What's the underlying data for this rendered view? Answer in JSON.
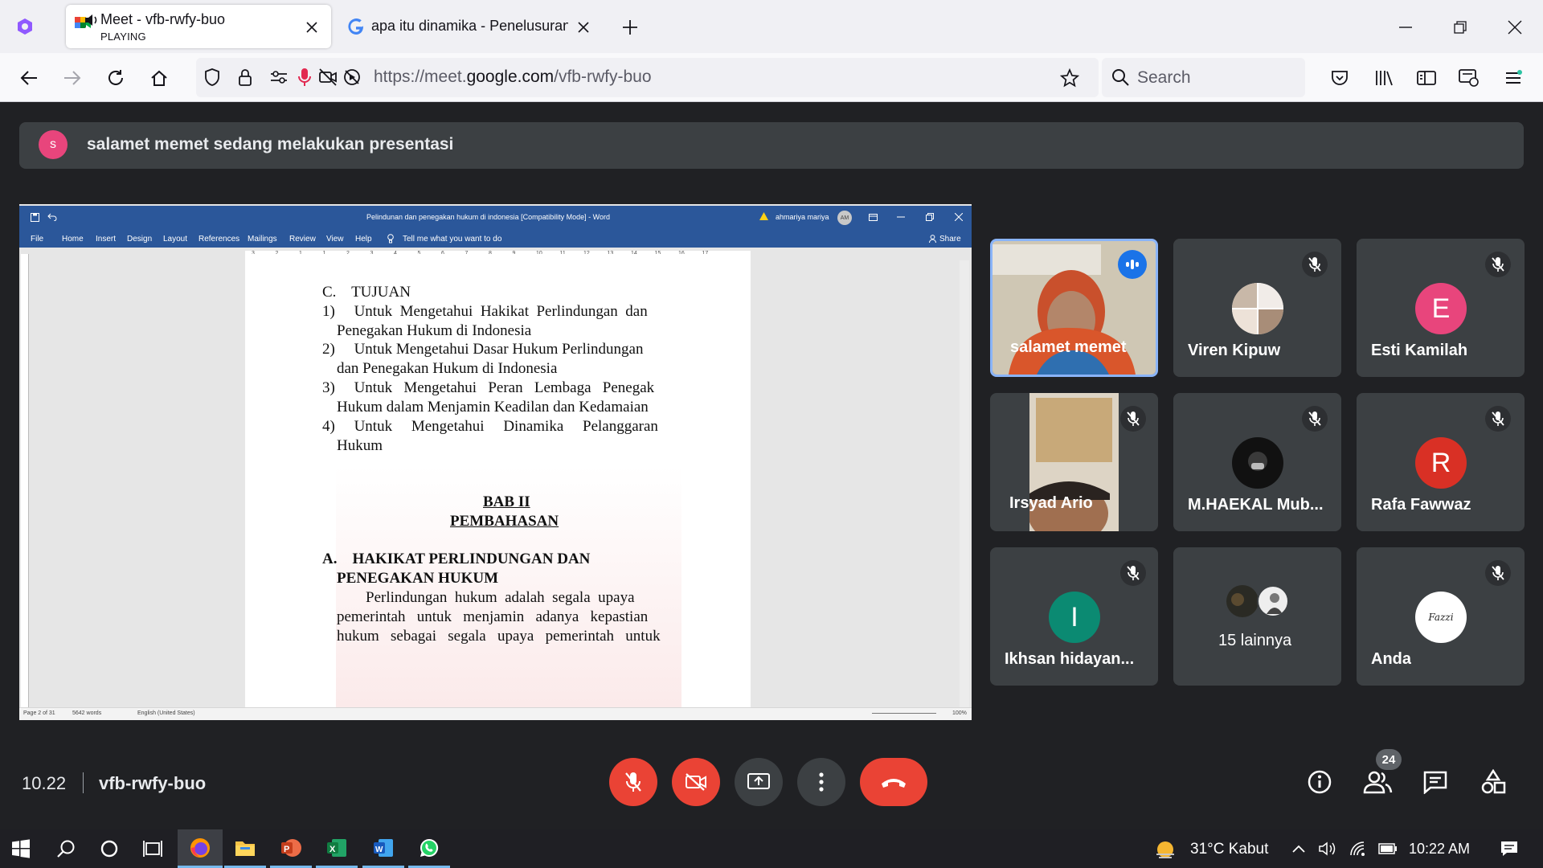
{
  "browser": {
    "tabs": [
      {
        "title": "Meet - vfb-rwfy-buo",
        "subtitle": "PLAYING",
        "active": true
      },
      {
        "title": "apa itu dinamika - Penelusuran Google",
        "active": false
      }
    ],
    "url": {
      "prefix": "https://meet.",
      "domain": "google.com",
      "path": "/vfb-rwfy-buo"
    },
    "search_placeholder": "Search",
    "icons": [
      "extensions-icon",
      "back-icon",
      "forward-icon",
      "reload-icon",
      "home-icon",
      "shield-icon",
      "lock-icon",
      "permissions-icon",
      "microphone-icon",
      "camera-off-icon",
      "autoplay-blocked-icon",
      "bookmark-star-icon",
      "pocket-icon",
      "library-icon",
      "sidebar-icon",
      "synced-tabs-icon",
      "menu-icon"
    ]
  },
  "meet": {
    "banner": {
      "avatar_letter": "s",
      "text": "salamet memet sedang melakukan presentasi",
      "avatar_color": "#e8457c"
    },
    "word": {
      "title": "Pelindunan dan penegakan hukum di indonesia [Compatibility Mode] - Word",
      "user": "ahmariya mariya",
      "user_initials": "AM",
      "ribbon": [
        "File",
        "Home",
        "Insert",
        "Design",
        "Layout",
        "References",
        "Mailings",
        "Review",
        "View",
        "Help",
        "Tell me what you want to do",
        "Share"
      ],
      "status": {
        "page": "Page 2 of 31",
        "words": "5642 words",
        "language": "English (United States)",
        "zoom": "100%"
      },
      "ruler_numbers": [
        "3",
        "2",
        "1",
        "1",
        "2",
        "3",
        "4",
        "5",
        "6",
        "7",
        "8",
        "9",
        "10",
        "11",
        "12",
        "13",
        "14",
        "15",
        "16",
        "17"
      ],
      "doc_lines": [
        "C.    TUJUAN",
        "1)     Untuk  Mengetahui  Hakikat  Perlindungan  dan",
        "Penegakan Hukum di Indonesia",
        "2)     Untuk Mengetahui Dasar Hukum Perlindungan",
        "dan Penegakan Hukum di Indonesia",
        "3)     Untuk   Mengetahui   Peran   Lembaga   Penegak",
        "Hukum dalam Menjamin Keadilan dan Kedamaian",
        "4)     Untuk     Mengetahui     Dinamika     Pelanggaran",
        "Hukum",
        "BAB II",
        "PEMBAHASAN",
        "A.    HAKIKAT PERLINDUNGAN DAN",
        "PENEGAKAN HUKUM",
        "Perlindungan  hukum  adalah  segala  upaya",
        "pemerintah   untuk   menjamin   adanya   kepastian",
        "hukum   sebagai   segala   upaya   pemerintah   untuk"
      ]
    },
    "participants": [
      {
        "name": "salamet memet",
        "type": "video",
        "speaking": true
      },
      {
        "name": "Viren Kipuw",
        "type": "photo",
        "muted": true
      },
      {
        "name": "Esti Kamilah",
        "type": "letter",
        "letter": "E",
        "color": "#e8457c",
        "muted": true
      },
      {
        "name": "Irsyad Ario",
        "type": "video",
        "muted": true
      },
      {
        "name": "M.HAEKAL Mub...",
        "type": "photo",
        "muted": true
      },
      {
        "name": "Rafa Fawwaz",
        "type": "letter",
        "letter": "R",
        "color": "#d93025",
        "muted": true
      },
      {
        "name": "Ikhsan hidayan...",
        "type": "letter",
        "letter": "I",
        "color": "#0b8a72",
        "muted": true
      },
      {
        "name": "15 lainnya",
        "type": "group"
      },
      {
        "name": "Anda",
        "type": "logo",
        "logo_text": "Fazzi",
        "muted": true
      }
    ],
    "footer": {
      "time": "10.22",
      "meeting_code": "vfb-rwfy-buo",
      "people_count": "24"
    }
  },
  "taskbar": {
    "weather": "31°C  Kabut",
    "time": "10:22 AM",
    "apps": [
      "windows-start-icon",
      "search-icon",
      "cortana-icon",
      "task-view-icon",
      "firefox-icon",
      "file-explorer-icon",
      "powerpoint-icon",
      "excel-icon",
      "word-icon",
      "whatsapp-icon"
    ]
  }
}
